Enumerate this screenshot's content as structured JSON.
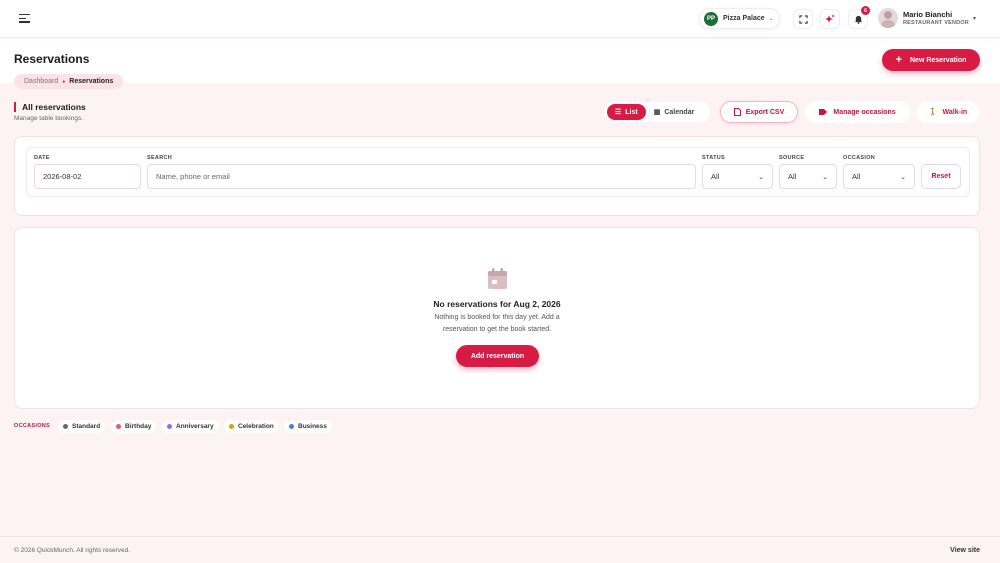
{
  "topbar": {
    "store": {
      "logo_text": "PP",
      "name": "Pizza Palace"
    },
    "notifications_count": "6",
    "user": {
      "name": "Mario Bianchi",
      "role": "RESTAURANT VENDOR"
    }
  },
  "header": {
    "title": "Reservations",
    "breadcrumb": [
      "Dashboard",
      "Reservations"
    ],
    "new_button": "New Reservation"
  },
  "section": {
    "title": "All reservations",
    "subtitle": "Manage table bookings.",
    "view_list": "List",
    "view_calendar": "Calendar",
    "export": "Export CSV",
    "manage_occasions": "Manage occasions",
    "walk_in": "Walk-in"
  },
  "filters": {
    "date_label": "DATE",
    "date_value": "2026-08-02",
    "search_label": "SEARCH",
    "search_placeholder": "Name, phone or email",
    "status_label": "STATUS",
    "status_value": "All",
    "source_label": "SOURCE",
    "source_value": "All",
    "occasion_label": "OCCASION",
    "occasion_value": "All",
    "reset": "Reset"
  },
  "empty": {
    "title": "No reservations for Aug 2, 2026",
    "description": "Nothing is booked for this day yet. Add a reservation to get the book started.",
    "button": "Add reservation"
  },
  "occasions": {
    "label": "OCCASIONS",
    "items": [
      {
        "label": "Standard",
        "color": "#6b6b6b"
      },
      {
        "label": "Birthday",
        "color": "#e05a7a"
      },
      {
        "label": "Anniversary",
        "color": "#9b6be0"
      },
      {
        "label": "Celebration",
        "color": "#d4a017"
      },
      {
        "label": "Business",
        "color": "#4a7fd4"
      }
    ]
  },
  "footer": {
    "copyright": "© 2026 QuickMunch. All rights reserved.",
    "view_site": "View site"
  },
  "colors": {
    "accent": "#d81b45",
    "background": "#fdf3f5"
  }
}
